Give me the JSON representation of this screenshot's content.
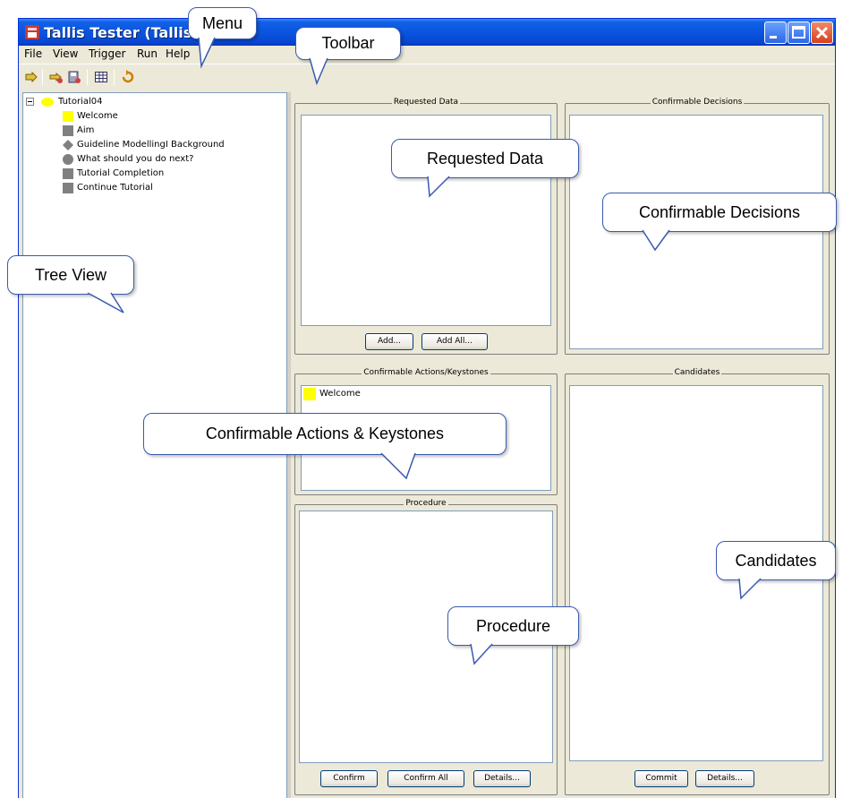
{
  "window": {
    "title": "Tallis Tester (Tallis Re",
    "controls": [
      "minimize",
      "maximize",
      "close"
    ]
  },
  "menu": {
    "items": [
      "File",
      "View",
      "Trigger",
      "Run",
      "Help"
    ]
  },
  "toolbar": {
    "icons": [
      "open-icon",
      "load-icon",
      "save-icon",
      "table-icon",
      "refresh-icon"
    ]
  },
  "tree": {
    "root": "Tutorial04",
    "nodes": [
      {
        "label": "Welcome",
        "icon": "yellow-square-icon"
      },
      {
        "label": "Aim",
        "icon": "gray-square-icon"
      },
      {
        "label": "Guideline ModellingI Background",
        "icon": "diamond-icon"
      },
      {
        "label": "What should you do next?",
        "icon": "circle-icon"
      },
      {
        "label": "Tutorial Completion",
        "icon": "gray-square-icon"
      },
      {
        "label": "Continue Tutorial",
        "icon": "gray-square-icon"
      }
    ]
  },
  "panels": {
    "requested_data": {
      "title": "Requested Data",
      "add_label": "Add...",
      "add_all_label": "Add All..."
    },
    "confirmable_decisions": {
      "title": "Confirmable Decisions"
    },
    "confirmable_actions": {
      "title": "Confirmable Actions/Keystones",
      "items": [
        "Welcome"
      ]
    },
    "procedure": {
      "title": "Procedure",
      "confirm_label": "Confirm",
      "confirm_all_label": "Confirm All",
      "details_label": "Details..."
    },
    "candidates": {
      "title": "Candidates",
      "commit_label": "Commit",
      "details_label": "Details..."
    }
  },
  "callouts": {
    "menu": "Menu",
    "toolbar": "Toolbar",
    "tree_view": "Tree View",
    "requested_data": "Requested Data",
    "confirmable_decisions": "Confirmable Decisions",
    "confirmable_actions": "Confirmable Actions & Keystones",
    "candidates": "Candidates",
    "procedure": "Procedure"
  },
  "colors": {
    "titlebar": "#0a55e0",
    "window_bg": "#ece9d8",
    "callout_border": "#3a5ab0",
    "yellow_node": "#ffff00",
    "gray_node": "#808080"
  }
}
